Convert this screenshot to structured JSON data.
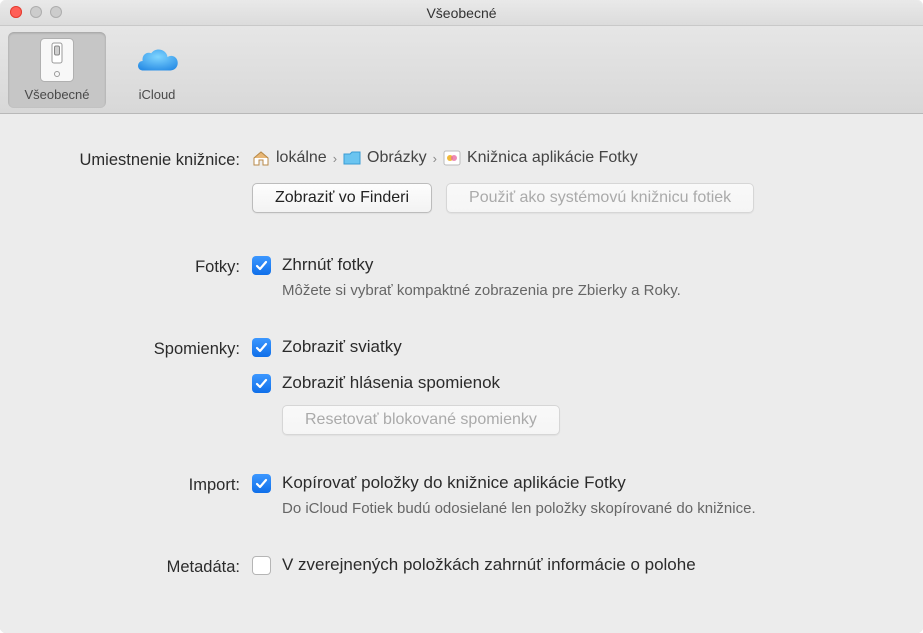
{
  "window": {
    "title": "Všeobecné"
  },
  "toolbar": {
    "general": {
      "label": "Všeobecné"
    },
    "icloud": {
      "label": "iCloud"
    }
  },
  "location": {
    "label": "Umiestnenie knižnice:",
    "crumbs": [
      "lokálne",
      "Obrázky",
      "Knižnica aplikácie Fotky"
    ],
    "show_in_finder": "Zobraziť vo Finderi",
    "use_as_system": "Použiť ako systémovú knižnicu fotiek"
  },
  "photos": {
    "label": "Fotky:",
    "summarize": "Zhrnúť fotky",
    "desc": "Môžete si vybrať kompaktné zobrazenia pre Zbierky a Roky."
  },
  "memories": {
    "label": "Spomienky:",
    "show_holidays": "Zobraziť sviatky",
    "show_notifications": "Zobraziť hlásenia spomienok",
    "reset_blocked": "Resetovať blokované spomienky"
  },
  "import": {
    "label": "Import:",
    "copy_items": "Kopírovať položky do knižnice aplikácie Fotky",
    "desc": "Do iCloud Fotiek budú odosielané len položky skopírované do knižnice."
  },
  "metadata": {
    "label": "Metadáta:",
    "include_location": "V zverejnených položkách zahrnúť informácie o polohe"
  }
}
